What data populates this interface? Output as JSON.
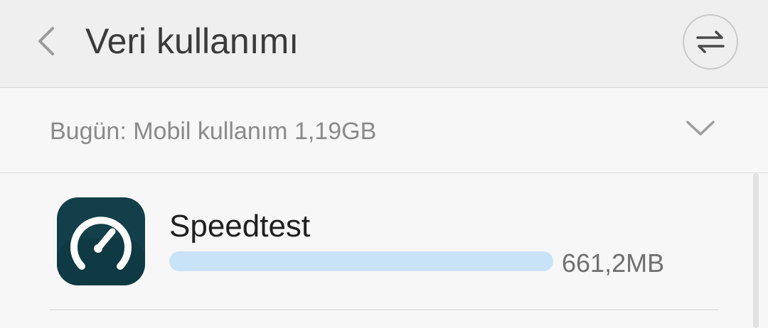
{
  "header": {
    "title": "Veri kullanımı",
    "back_icon": "chevron-left-icon",
    "action_icon": "swap-arrows-icon"
  },
  "summary": {
    "text": "Bugün: Mobil kullanım 1,19GB",
    "dropdown_icon": "chevron-down-icon"
  },
  "apps": [
    {
      "name": "Speedtest",
      "usage": "661,2MB",
      "usage_fraction": 1.0,
      "icon": "speedtest-gauge-icon"
    }
  ],
  "colors": {
    "header_bg": "#efefef",
    "page_bg": "#f7f7f7",
    "bar": "#c8e2f8",
    "icon_bg": "#123f4a"
  }
}
